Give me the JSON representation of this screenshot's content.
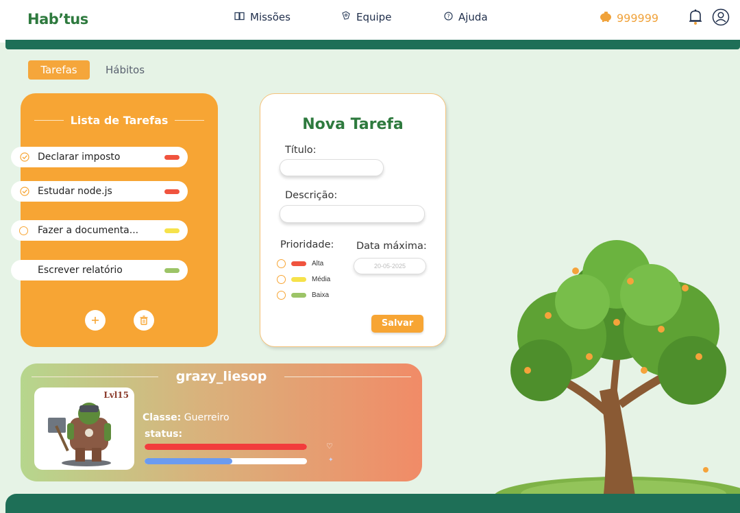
{
  "header": {
    "logo": "Hab’tus",
    "nav": [
      {
        "label": "Missões",
        "icon": "book-icon"
      },
      {
        "label": "Equipe",
        "icon": "team-icon"
      },
      {
        "label": "Ajuda",
        "icon": "help-icon"
      }
    ],
    "coins": "999999"
  },
  "tabs": [
    {
      "label": "Tarefas",
      "active": true
    },
    {
      "label": "Hábitos",
      "active": false
    }
  ],
  "task_list": {
    "title": "Lista de Tarefas",
    "tasks": [
      {
        "label": "Declarar imposto",
        "state": "done",
        "priority": "Alta",
        "color": "#f0533e"
      },
      {
        "label": "Estudar node.js",
        "state": "done",
        "priority": "Alta",
        "color": "#f0533e"
      },
      {
        "label": "Fazer a documenta...",
        "state": "open",
        "priority": "Média",
        "color": "#f6e24b"
      },
      {
        "label": "Escrever relatório",
        "state": "none",
        "priority": "Baixa",
        "color": "#9cc467"
      }
    ]
  },
  "new_task": {
    "title": "Nova Tarefa",
    "title_label": "Título:",
    "description_label": "Descrição:",
    "priority_label": "Prioridade:",
    "date_label": "Data máxima:",
    "date_placeholder": "20-05-2025",
    "priorities": [
      {
        "label": "Alta",
        "color": "#f0533e"
      },
      {
        "label": "Média",
        "color": "#f6e24b"
      },
      {
        "label": "Baixa",
        "color": "#9cc467"
      }
    ],
    "save_label": "Salvar"
  },
  "profile": {
    "username": "grazy_liesop",
    "level": "Lvl15",
    "class_label": "Classe:",
    "class_value": "Guerreiro",
    "status_label": "status:",
    "health_fraction": 1.0,
    "mana_fraction": 0.54,
    "health_color": "#f23c3c",
    "mana_color": "#6b9bf0"
  },
  "colors": {
    "brand_green": "#1e6f57",
    "accent_orange": "#f7a534",
    "background": "#e6f3e6"
  }
}
